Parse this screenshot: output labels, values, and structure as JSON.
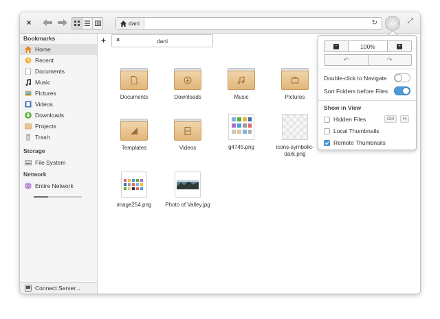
{
  "toolbar": {
    "close_glyph": "×",
    "back_glyph": "←",
    "forward_glyph": "→",
    "path_crumb": "dani",
    "reload_glyph": "↻",
    "maximize_glyph": "⤢"
  },
  "sidebar": {
    "bookmarks_header": "Bookmarks",
    "bookmarks": [
      {
        "label": "Home",
        "icon": "home-icon",
        "active": true
      },
      {
        "label": "Recent",
        "icon": "recent-icon"
      },
      {
        "label": "Documents",
        "icon": "document-icon"
      },
      {
        "label": "Music",
        "icon": "music-icon"
      },
      {
        "label": "Pictures",
        "icon": "pictures-icon"
      },
      {
        "label": "Videos",
        "icon": "videos-icon"
      },
      {
        "label": "Downloads",
        "icon": "download-icon"
      },
      {
        "label": "Projects",
        "icon": "folder-icon"
      },
      {
        "label": "Trash",
        "icon": "trash-icon"
      }
    ],
    "storage_header": "Storage",
    "storage_item": "File System",
    "storage_usage_fraction": 0.3,
    "network_header": "Network",
    "network_item": "Entire Network",
    "connect_server": "Connect Server..."
  },
  "tabs": {
    "add_glyph": "+",
    "close_glyph": "×",
    "active_tab": "dani"
  },
  "files": [
    {
      "label": "Documents",
      "kind": "folder",
      "emblem": "document-icon"
    },
    {
      "label": "Downloads",
      "kind": "folder",
      "emblem": "download-icon"
    },
    {
      "label": "Music",
      "kind": "folder",
      "emblem": "music-icon"
    },
    {
      "label": "Pictures",
      "kind": "folder",
      "emblem": "pictures-icon"
    },
    {
      "label": "Templates",
      "kind": "folder",
      "emblem": "template-icon"
    },
    {
      "label": "Videos",
      "kind": "folder",
      "emblem": "film-icon"
    },
    {
      "label": "g4745.png",
      "kind": "image"
    },
    {
      "label": "icons-symbolic-dark.png",
      "kind": "image"
    },
    {
      "label": "image254.png",
      "kind": "image"
    },
    {
      "label": "Photo of Valley.jpg",
      "kind": "image"
    }
  ],
  "popover": {
    "zoom_out_glyph": "−",
    "zoom_value": "100%",
    "zoom_in_glyph": "+",
    "undo_glyph": "↶",
    "redo_glyph": "↷",
    "double_click_label": "Double-click to Navigate",
    "double_click_on": false,
    "sort_folders_label": "Sort Folders before Files",
    "sort_folders_on": true,
    "show_in_view_header": "Show in View",
    "hidden_files_label": "Hidden Files",
    "hidden_files_checked": false,
    "shortcut_ctrl": "Ctrl",
    "shortcut_h": "H",
    "local_thumbnails_label": "Local Thumbnails",
    "local_thumbnails_checked": false,
    "remote_thumbnails_label": "Remote Thumbnails",
    "remote_thumbnails_checked": true
  },
  "colors": {
    "accent": "#4e9ad9",
    "folder": "#e1b67a"
  }
}
